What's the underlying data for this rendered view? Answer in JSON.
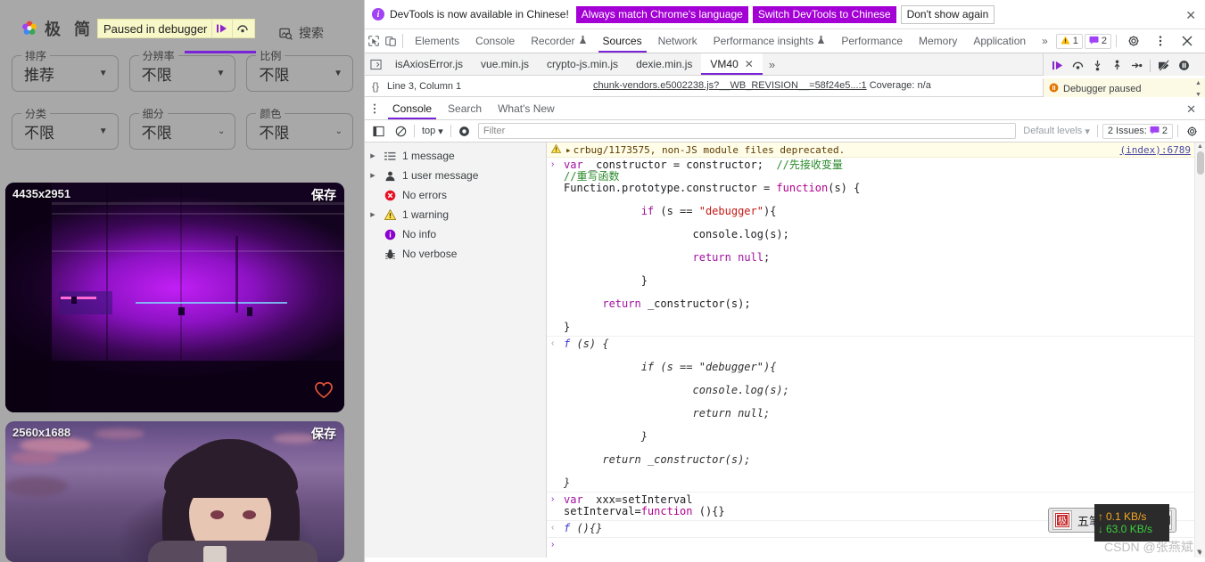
{
  "site": {
    "title": "极 简 壁",
    "logo_icon": "colorful-flower-logo-icon",
    "search_label": "搜索",
    "search_icon": "image-search-icon",
    "paused_banner": {
      "text": "Paused in debugger",
      "resume_icon": "resume-script-icon",
      "step_icon": "step-over-icon"
    },
    "filters": [
      {
        "label": "排序",
        "value": "推荐",
        "arrow": "▼"
      },
      {
        "label": "分辨率",
        "value": "不限",
        "arrow": "▼"
      },
      {
        "label": "比例",
        "value": "不限",
        "arrow": "▼"
      },
      {
        "label": "分类",
        "value": "不限",
        "arrow": "▼"
      },
      {
        "label": "细分",
        "value": "不限",
        "arrow": "⌄"
      },
      {
        "label": "颜色",
        "value": "不限",
        "arrow": "⌄"
      }
    ],
    "cards": [
      {
        "resolution": "4435x2951",
        "save_label": "保存",
        "favorite_icon": "heart-outline-icon"
      },
      {
        "resolution": "2560x1688",
        "save_label": "保存"
      }
    ]
  },
  "devtools": {
    "infobar": {
      "icon": "info-circle-icon",
      "message": "DevTools is now available in Chinese!",
      "btn_always_match": "Always match Chrome's language",
      "btn_switch": "Switch DevTools to Chinese",
      "btn_dismiss": "Don't show again",
      "close_icon": "close-icon"
    },
    "tabbar": {
      "inspect_icon": "inspect-element-icon",
      "device_icon": "toggle-device-toolbar-icon",
      "tabs": [
        {
          "label": "Elements",
          "active": false
        },
        {
          "label": "Console",
          "active": false
        },
        {
          "label": "Recorder",
          "active": false,
          "badge": "experimental-flask-icon"
        },
        {
          "label": "Sources",
          "active": true
        },
        {
          "label": "Network",
          "active": false
        },
        {
          "label": "Performance insights",
          "active": false,
          "badge": "experimental-flask-icon"
        },
        {
          "label": "Performance",
          "active": false
        },
        {
          "label": "Memory",
          "active": false
        },
        {
          "label": "Application",
          "active": false
        }
      ],
      "more_icon": "more-tabs-chevron-icon",
      "warning_count": "1",
      "warning_icon": "warning-triangle-icon",
      "issue_count": "2",
      "issue_icon": "issues-flag-icon",
      "settings_icon": "gear-icon",
      "kebab_icon": "more-options-icon",
      "close_icon": "close-devtools-icon"
    },
    "filetabs": {
      "navigator_icon": "show-navigator-icon",
      "tabs": [
        {
          "label": "isAxiosError.js",
          "active": false
        },
        {
          "label": "vue.min.js",
          "active": false
        },
        {
          "label": "crypto-js.min.js",
          "active": false
        },
        {
          "label": "dexie.min.js",
          "active": false
        },
        {
          "label": "VM40",
          "active": true,
          "close_icon": "close-tab-icon"
        }
      ],
      "more_icon": "more-tabs-chevron-icon",
      "debugger_sidebar_icon": "show-debugger-sidebar-icon"
    },
    "debugger_toolbar": {
      "buttons": [
        "resume-script-execution-icon",
        "step-over-next-function-call-icon",
        "step-into-next-function-call-icon",
        "step-out-of-current-function-icon",
        "step-icon",
        "deactivate-breakpoints-icon",
        "pause-on-exceptions-icon"
      ]
    },
    "statusline": {
      "format_icon": "pretty-print-braces-icon",
      "position": "Line 3, Column 1",
      "source_file": "chunk-vendors.e5002238.js?__WB_REVISION__=58f24e5...:1",
      "coverage": "Coverage: n/a"
    },
    "paused_strip": {
      "icon": "pause-circle-icon",
      "text": "Debugger paused"
    },
    "drawer": {
      "kebab_icon": "drawer-more-options-icon",
      "tabs": [
        {
          "label": "Console",
          "active": true
        },
        {
          "label": "Search",
          "active": false
        },
        {
          "label": "What's New",
          "active": false
        }
      ],
      "close_icon": "close-drawer-icon"
    },
    "filterbar": {
      "sidebar_toggle_icon": "console-sidebar-toggle-icon",
      "clear_icon": "clear-console-icon",
      "context": "top",
      "context_arrow": "▾",
      "live_expression_icon": "create-live-expression-icon",
      "filter_placeholder": "Filter",
      "filter_value": "",
      "levels_label": "Default levels",
      "levels_arrow": "▾",
      "issues_label": "2 Issues:",
      "issues_icon": "issues-flag-icon",
      "issues_count": "2",
      "settings_icon": "console-settings-gear-icon"
    },
    "console_sidebar": [
      {
        "label": "1 message",
        "icon": "list-icon",
        "expandable": true
      },
      {
        "label": "1 user message",
        "icon": "user-icon",
        "expandable": true
      },
      {
        "label": "No errors",
        "icon": "error-circle-icon",
        "expandable": false
      },
      {
        "label": "1 warning",
        "icon": "warning-triangle-icon",
        "expandable": true
      },
      {
        "label": "No info",
        "icon": "info-circle-icon",
        "expandable": false
      },
      {
        "label": "No verbose",
        "icon": "bug-icon",
        "expandable": false
      }
    ],
    "console_warning": {
      "icon": "warning-triangle-icon",
      "expand_arrow": "▸",
      "text": "crbug/1173575, non-JS module files deprecated.",
      "source": "(index):6789"
    },
    "console_entries": [
      {
        "gutter": "›",
        "type": "input",
        "lines": [
          "var _constructor = constructor;  //先接收变量",
          "//重写函数",
          "Function.prototype.constructor = function(s) {",
          "",
          "            if (s == \"debugger\"){",
          "",
          "                    console.log(s);",
          "",
          "                    return null;",
          "",
          "            }",
          "",
          "      return _constructor(s);",
          "",
          "}"
        ]
      },
      {
        "gutter": "‹",
        "type": "output",
        "lines": [
          "f (s) {",
          "",
          "            if (s == \"debugger\"){",
          "",
          "                    console.log(s);",
          "",
          "                    return null;",
          "",
          "            }",
          "",
          "      return _constructor(s);",
          "",
          "}"
        ]
      },
      {
        "gutter": "›",
        "type": "input",
        "lines": [
          "var  xxx=setInterval",
          "setInterval=function (){}"
        ]
      },
      {
        "gutter": "‹",
        "type": "output",
        "lines": [
          "f (){}"
        ]
      },
      {
        "gutter": "›",
        "type": "prompt",
        "lines": [
          ""
        ]
      }
    ]
  },
  "overlays": {
    "ime": {
      "logo_icon": "sogou-ime-logo-icon",
      "mode_label": "五笔拼音",
      "mouse_icon": "ime-mouse-icon",
      "keyboard_icon": "soft-keyboard-icon"
    },
    "network_monitor": {
      "up_arrow": "↑",
      "upload": "0.1 KB/s",
      "down_arrow": "↓",
      "download": "63.0 KB/s"
    },
    "watermark": "CSDN @张燕斌"
  },
  "colors": {
    "accent_purple": "#7a24d8",
    "chrome_purple": "#a400d6",
    "pause_yellow": "#f7f7c8",
    "warn_bg": "#fffde7"
  }
}
